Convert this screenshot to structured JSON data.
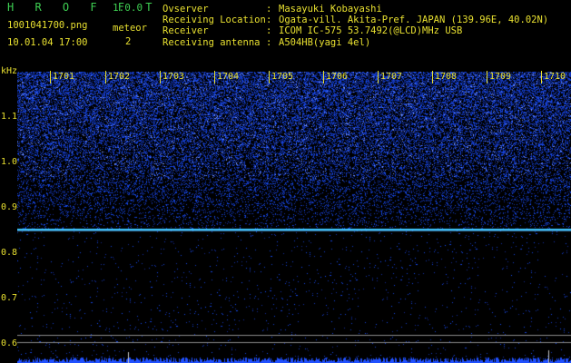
{
  "app": {
    "logo": "H R O F F T",
    "version": "1.0.0"
  },
  "file": {
    "name": "1001041700.png",
    "datetime": "10.01.04 17:00"
  },
  "meteor": {
    "label": "meteor",
    "count": "2"
  },
  "info": [
    {
      "key": "Ovserver",
      "value": "Masayuki Kobayashi"
    },
    {
      "key": "Receiving Location",
      "value": "Ogata-vill. Akita-Pref. JAPAN (139.96E, 40.02N)"
    },
    {
      "key": "Receiver",
      "value": "ICOM IC-575 53.7492(@LCD)MHz USB"
    },
    {
      "key": "Receiving antenna",
      "value": "A504HB(yagi 4el)"
    }
  ],
  "axis": {
    "unit": "kHz",
    "yticks": [
      "1.1",
      "1.0",
      "0.9",
      "0.8",
      "0.7",
      "0.6"
    ],
    "minutes": [
      "1701",
      "1702",
      "1703",
      "1704",
      "1705",
      "1706",
      "1707",
      "1708",
      "1709",
      "1710"
    ]
  },
  "colors": {
    "yellow": "#e8e030",
    "green": "#3ecf52",
    "noise": "#1e3cff",
    "carrier": "#40c8ff"
  }
}
